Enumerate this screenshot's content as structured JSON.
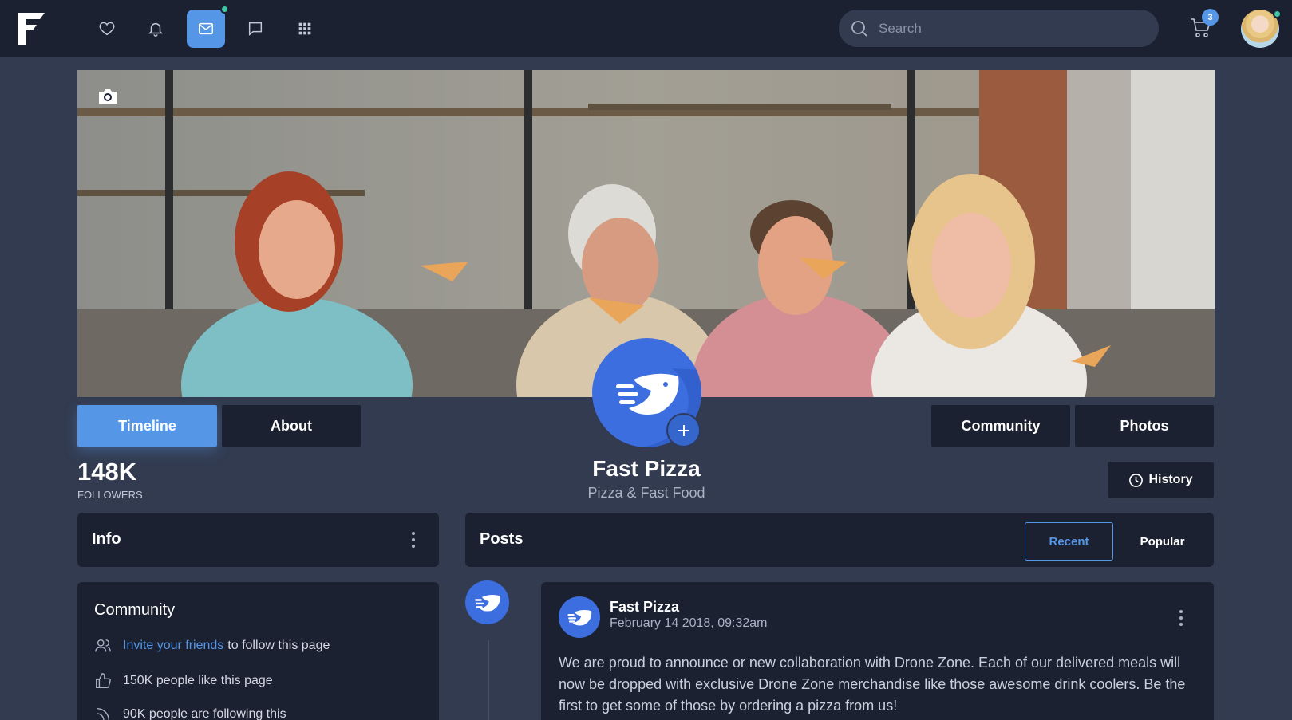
{
  "navbar": {
    "logo": "F",
    "icons": [
      "heart-icon",
      "bell-icon",
      "mail-icon",
      "chat-icon",
      "apps-grid-icon"
    ],
    "search": {
      "placeholder": "Search"
    },
    "cart_count": "3"
  },
  "profile_tabs": {
    "left": [
      "Timeline",
      "About"
    ],
    "right": [
      "Community",
      "Photos"
    ]
  },
  "page": {
    "name": "Fast Pizza",
    "category": "Pizza & Fast Food",
    "followers_count": "148K",
    "followers_label": "FOLLOWERS",
    "history_label": "History"
  },
  "info_card": {
    "title": "Info"
  },
  "posts_card": {
    "title": "Posts",
    "filters": [
      "Recent",
      "Popular"
    ],
    "active_filter": "Recent"
  },
  "community_card": {
    "title": "Community",
    "invite_link": "Invite your friends",
    "invite_rest": "to follow this page",
    "likes": "150K people like this page",
    "following": "90K people are following this"
  },
  "post": {
    "author": "Fast Pizza",
    "date": "February 14 2018, 09:32am",
    "body": "We are proud to announce or new collaboration with Drone Zone. Each of our delivered meals will now be dropped with exclusive Drone Zone merchandise like those awesome drink coolers. Be the first to get some of those by ordering a pizza from us!"
  },
  "colors": {
    "accent": "#5596e6",
    "navbar_bg": "#1b2130",
    "page_bg": "#323b50",
    "online_dot": "#3fc6a5",
    "brand_blue": "#3c6ee0"
  }
}
